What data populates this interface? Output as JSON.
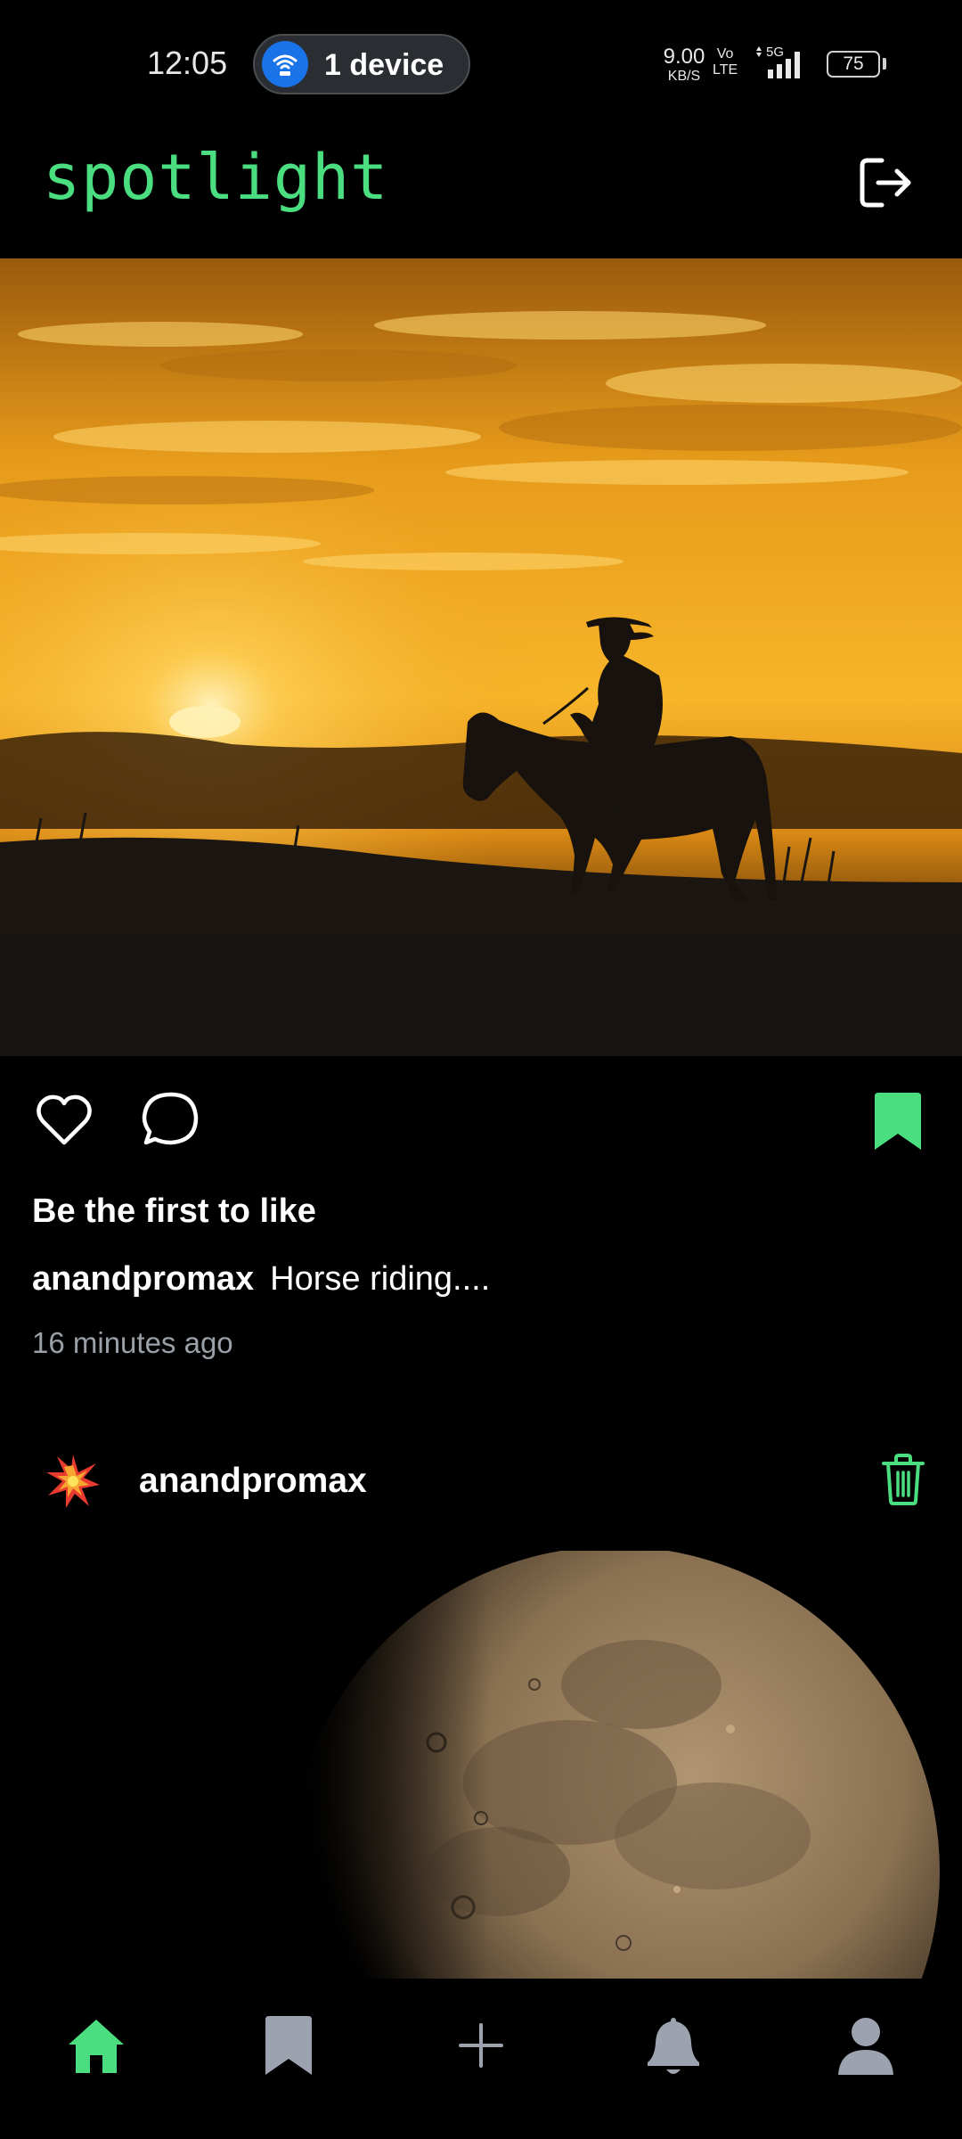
{
  "status_bar": {
    "time": "12:05",
    "hotspot_label": "1 device",
    "network_speed_value": "9.00",
    "network_speed_unit": "KB/S",
    "volte_line1": "Vo",
    "volte_line2": "LTE",
    "network_type": "5G",
    "battery": "75",
    "icons": [
      "wifi-hotspot-icon",
      "signal-icon",
      "battery-icon"
    ]
  },
  "header": {
    "app_title": "spotlight",
    "logout_icon": "logout-icon"
  },
  "post": {
    "image_description_icon": "sunset-cowboy-photo",
    "likes_text": "Be the first to like",
    "caption_username": "anandpromax",
    "caption_text": "Horse riding....",
    "time_ago": "16 minutes ago",
    "bookmarked": true
  },
  "next_post": {
    "username": "anandpromax",
    "delete_icon": "trash-icon",
    "image_icon": "moon-photo"
  },
  "bottom_nav": {
    "items": [
      {
        "icon": "home-icon",
        "active": true
      },
      {
        "icon": "bookmark-icon",
        "active": false
      },
      {
        "icon": "plus-icon",
        "active": false
      },
      {
        "icon": "bell-icon",
        "active": false
      },
      {
        "icon": "profile-icon",
        "active": false
      }
    ]
  },
  "colors": {
    "accent": "#4ade80",
    "background": "#000000",
    "muted_text": "#9aa0a8",
    "inactive_icon": "#9ca3af"
  }
}
